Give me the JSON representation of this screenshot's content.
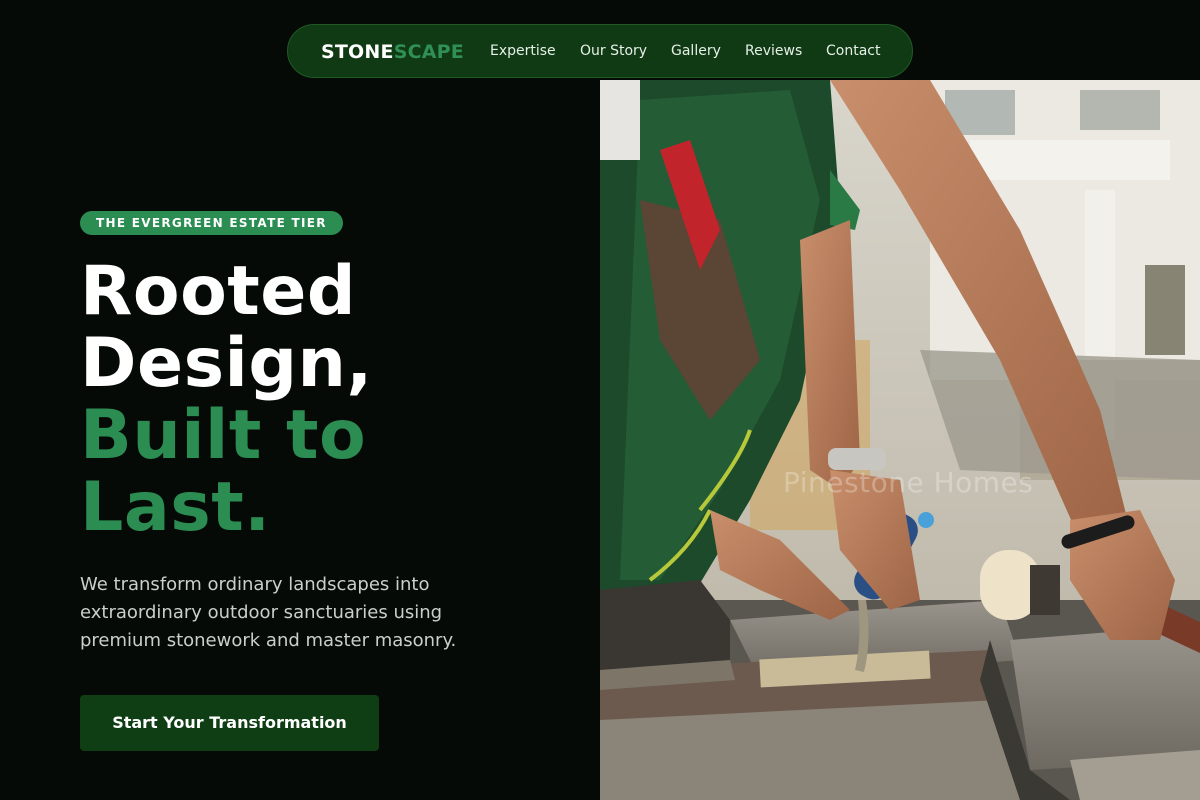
{
  "nav": {
    "brand_part1": "STONE",
    "brand_part2": "SCAPE",
    "links": [
      "Expertise",
      "Our Story",
      "Gallery",
      "Reviews",
      "Contact"
    ]
  },
  "hero": {
    "badge": "THE EVERGREEN ESTATE TIER",
    "headline_line1": "Rooted",
    "headline_line2": "Design,",
    "headline_line3": "Built to",
    "headline_line4": "Last.",
    "subtext": "We transform ordinary landscapes into extraordinary outdoor sanctuaries using premium stonework and master masonry.",
    "cta_label": "Start Your Transformation"
  },
  "photo": {
    "watermark": "Pinestone Homes"
  },
  "colors": {
    "background": "#050a07",
    "nav_bg": "#0f3a14",
    "accent_green": "#2b8d52",
    "cta_bg": "#103e14",
    "text_white": "#ffffff"
  }
}
